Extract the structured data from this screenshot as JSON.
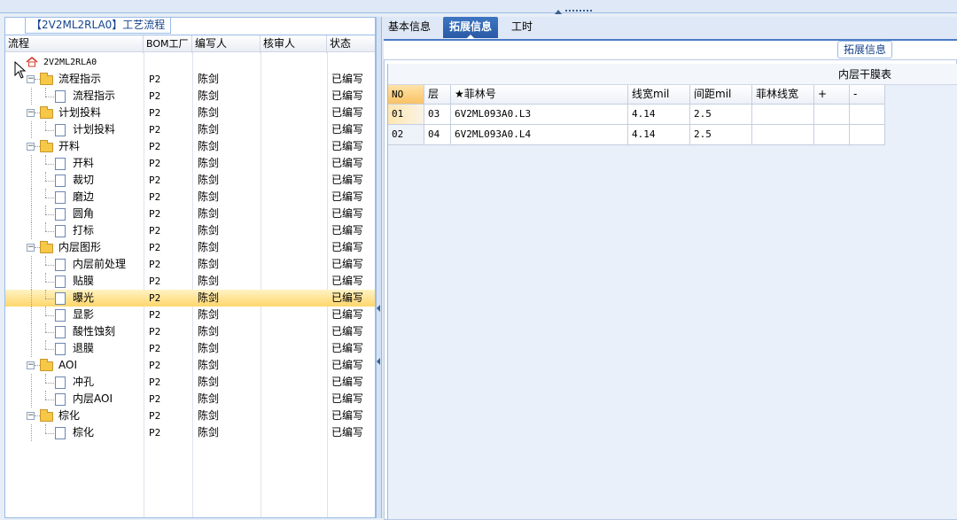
{
  "left_panel": {
    "title": "【2V2ML2RLA0】工艺流程",
    "columns": [
      "流程",
      "BOM工厂",
      "编写人",
      "核审人",
      "状态"
    ],
    "root": "2V2ML2RLA0",
    "rows": [
      {
        "name": "流程指示",
        "type": "folder",
        "bom": "P2",
        "writer": "陈剑",
        "reviewer": "",
        "status": "已编写"
      },
      {
        "name": "流程指示",
        "type": "doc",
        "bom": "P2",
        "writer": "陈剑",
        "reviewer": "",
        "status": "已编写"
      },
      {
        "name": "计划投料",
        "type": "folder",
        "bom": "P2",
        "writer": "陈剑",
        "reviewer": "",
        "status": "已编写"
      },
      {
        "name": "计划投料",
        "type": "doc",
        "bom": "P2",
        "writer": "陈剑",
        "reviewer": "",
        "status": "已编写"
      },
      {
        "name": "开料",
        "type": "folder",
        "bom": "P2",
        "writer": "陈剑",
        "reviewer": "",
        "status": "已编写"
      },
      {
        "name": "开料",
        "type": "doc",
        "bom": "P2",
        "writer": "陈剑",
        "reviewer": "",
        "status": "已编写"
      },
      {
        "name": "裁切",
        "type": "doc",
        "bom": "P2",
        "writer": "陈剑",
        "reviewer": "",
        "status": "已编写"
      },
      {
        "name": "磨边",
        "type": "doc",
        "bom": "P2",
        "writer": "陈剑",
        "reviewer": "",
        "status": "已编写"
      },
      {
        "name": "圆角",
        "type": "doc",
        "bom": "P2",
        "writer": "陈剑",
        "reviewer": "",
        "status": "已编写"
      },
      {
        "name": "打标",
        "type": "doc",
        "bom": "P2",
        "writer": "陈剑",
        "reviewer": "",
        "status": "已编写"
      },
      {
        "name": "内层图形",
        "type": "folder",
        "bom": "P2",
        "writer": "陈剑",
        "reviewer": "",
        "status": "已编写"
      },
      {
        "name": "内层前处理",
        "type": "doc",
        "bom": "P2",
        "writer": "陈剑",
        "reviewer": "",
        "status": "已编写"
      },
      {
        "name": "贴膜",
        "type": "doc",
        "bom": "P2",
        "writer": "陈剑",
        "reviewer": "",
        "status": "已编写"
      },
      {
        "name": "曝光",
        "type": "doc",
        "bom": "P2",
        "writer": "陈剑",
        "reviewer": "",
        "status": "已编写",
        "selected": true
      },
      {
        "name": "显影",
        "type": "doc",
        "bom": "P2",
        "writer": "陈剑",
        "reviewer": "",
        "status": "已编写"
      },
      {
        "name": "酸性蚀刻",
        "type": "doc",
        "bom": "P2",
        "writer": "陈剑",
        "reviewer": "",
        "status": "已编写"
      },
      {
        "name": "退膜",
        "type": "doc",
        "bom": "P2",
        "writer": "陈剑",
        "reviewer": "",
        "status": "已编写"
      },
      {
        "name": "AOI",
        "type": "folder",
        "bom": "P2",
        "writer": "陈剑",
        "reviewer": "",
        "status": "已编写"
      },
      {
        "name": "冲孔",
        "type": "doc",
        "bom": "P2",
        "writer": "陈剑",
        "reviewer": "",
        "status": "已编写"
      },
      {
        "name": "内层AOI",
        "type": "doc",
        "bom": "P2",
        "writer": "陈剑",
        "reviewer": "",
        "status": "已编写"
      },
      {
        "name": "棕化",
        "type": "folder",
        "bom": "P2",
        "writer": "陈剑",
        "reviewer": "",
        "status": "已编写"
      },
      {
        "name": "棕化",
        "type": "doc",
        "bom": "P2",
        "writer": "陈剑",
        "reviewer": "",
        "status": "已编写"
      }
    ]
  },
  "tabs": [
    "基本信息",
    "拓展信息",
    "工时"
  ],
  "active_tab": "拓展信息",
  "right_panel": {
    "legend": "拓展信息",
    "grid_title": "内层干膜表",
    "columns": [
      "NO",
      "层",
      "★菲林号",
      "线宽mil",
      "间距mil",
      "菲林线宽",
      "+",
      "-"
    ],
    "rows": [
      {
        "no": "01",
        "layer": "03",
        "film": "6V2ML093A0.L3",
        "width": "4.14",
        "spacing": "2.5",
        "film_width": "",
        "plus": "",
        "minus": ""
      },
      {
        "no": "02",
        "layer": "04",
        "film": "6V2ML093A0.L4",
        "width": "4.14",
        "spacing": "2.5",
        "film_width": "",
        "plus": "",
        "minus": ""
      }
    ]
  },
  "colors": {
    "accent": "#2a5aa5",
    "selected_row": "#ffd66b",
    "border": "#99bbe8"
  }
}
